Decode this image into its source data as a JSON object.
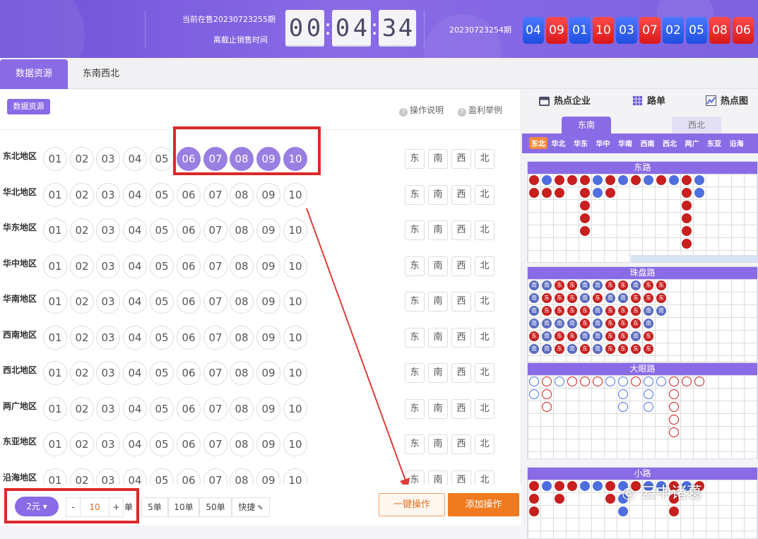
{
  "header": {
    "current_period": "当前在售20230723255期",
    "deadline_label": "离截止销售时间",
    "countdown_digits": [
      "0",
      "0",
      "0",
      "4",
      "3",
      "4"
    ],
    "last_period": "20230723254期",
    "last_result": [
      {
        "n": "04",
        "c": "blue"
      },
      {
        "n": "09",
        "c": "red"
      },
      {
        "n": "01",
        "c": "blue"
      },
      {
        "n": "10",
        "c": "red"
      },
      {
        "n": "03",
        "c": "blue"
      },
      {
        "n": "07",
        "c": "red"
      },
      {
        "n": "02",
        "c": "blue"
      },
      {
        "n": "05",
        "c": "blue"
      },
      {
        "n": "08",
        "c": "red"
      },
      {
        "n": "06",
        "c": "red"
      }
    ]
  },
  "tabs": [
    "数据资源",
    "东南西北"
  ],
  "left": {
    "pill": "数据资源",
    "help1": "操作说明",
    "help2": "盈利举例",
    "numbers": [
      "01",
      "02",
      "03",
      "04",
      "05",
      "06",
      "07",
      "08",
      "09",
      "10"
    ],
    "directions": [
      "东",
      "南",
      "西",
      "北"
    ],
    "rows": [
      {
        "label": "东北地区",
        "selected": [
          "06",
          "07",
          "08",
          "09",
          "10"
        ]
      },
      {
        "label": "华北地区",
        "selected": []
      },
      {
        "label": "华东地区",
        "selected": []
      },
      {
        "label": "华中地区",
        "selected": []
      },
      {
        "label": "华南地区",
        "selected": []
      },
      {
        "label": "西南地区",
        "selected": []
      },
      {
        "label": "西北地区",
        "selected": []
      },
      {
        "label": "两广地区",
        "selected": []
      },
      {
        "label": "东亚地区",
        "selected": []
      },
      {
        "label": "沿海地区",
        "selected": []
      }
    ]
  },
  "bottom": {
    "unit": "2元",
    "minus": "-",
    "qty": "10",
    "plus": "+",
    "qty_unit": "单",
    "quick": [
      "5单",
      "10单",
      "50单"
    ],
    "shortcut": "快捷",
    "one_click": "一键操作",
    "add": "添加操作"
  },
  "right": {
    "tabs": [
      "热点企业",
      "路单",
      "热点图"
    ],
    "subtabs": [
      "东南",
      "西北"
    ],
    "regions": [
      "东北",
      "华北",
      "华东",
      "华中",
      "华南",
      "西南",
      "西北",
      "两广",
      "东亚",
      "沿海"
    ],
    "panels": [
      {
        "title": "东路",
        "cols": [
          [
            "R",
            "R"
          ],
          [
            "B",
            "R"
          ],
          [
            "R",
            "R"
          ],
          [
            "R"
          ],
          [
            "R",
            "R",
            "R",
            "R",
            "R"
          ],
          [
            "B",
            "B"
          ],
          [
            "R",
            "R"
          ],
          [
            "B"
          ],
          [
            "R"
          ],
          [
            "B"
          ],
          [
            "R"
          ],
          [
            "B"
          ],
          [
            "R",
            "R",
            "R",
            "R",
            "R",
            "R"
          ],
          [
            "B",
            "B"
          ]
        ]
      },
      {
        "title": "珠盘路",
        "cols": [
          [
            "B",
            "B",
            "B",
            "B",
            "R",
            "B"
          ],
          [
            "B",
            "R",
            "R",
            "B",
            "B",
            "B"
          ],
          [
            "R",
            "R",
            "R",
            "B",
            "R",
            "R"
          ],
          [
            "R",
            "R",
            "R",
            "B",
            "R",
            "B"
          ],
          [
            "B",
            "B",
            "R",
            "R",
            "B",
            "R"
          ],
          [
            "B",
            "R",
            "B",
            "B",
            "B",
            "B"
          ],
          [
            "R",
            "B",
            "R",
            "R",
            "R",
            "R"
          ],
          [
            "R",
            "B",
            "R",
            "R",
            "R",
            "R"
          ],
          [
            "B",
            "R",
            "R",
            "R",
            "B",
            "R"
          ],
          [
            "R",
            "R",
            "B",
            "B",
            "R",
            "R"
          ],
          [
            "R",
            "R",
            "B"
          ]
        ]
      },
      {
        "title": "大眼路",
        "cols": [
          [
            "bb",
            "bb"
          ],
          [
            "rr",
            "rr",
            "rr"
          ],
          [
            "bb"
          ],
          [
            "rr"
          ],
          [
            "rr"
          ],
          [
            "rr"
          ],
          [
            "bb"
          ],
          [
            "bb",
            "bb",
            "bb"
          ],
          [
            "rr"
          ],
          [
            "bb",
            "bb",
            "bb"
          ],
          [
            "bb"
          ],
          [
            "rr",
            "rr",
            "rr",
            "rr",
            "rr"
          ],
          [
            "rr"
          ],
          [
            "rr"
          ]
        ]
      },
      {
        "title": "小路",
        "cols": [
          [
            "R",
            "R",
            "R"
          ],
          [
            "B"
          ],
          [
            "R",
            "R"
          ],
          [
            "R"
          ],
          [
            "B"
          ],
          [
            "B"
          ],
          [
            "R",
            "R"
          ],
          [
            "B",
            "B",
            "B"
          ],
          [
            "R"
          ],
          [
            "B"
          ],
          [
            "B"
          ],
          [
            "R",
            "R",
            "R"
          ],
          [
            "B"
          ],
          [
            "R"
          ]
        ]
      }
    ]
  },
  "watermark": "云中诸葛"
}
